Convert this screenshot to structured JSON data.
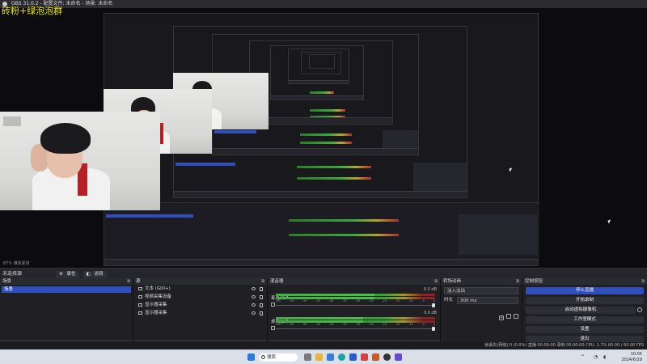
{
  "window": {
    "title": "OBS 31.0.2 - 配置文件: 未命名 - 场景: 未命名"
  },
  "overlay": {
    "text": "砖粉+绿泡泡群"
  },
  "preview_status": "87%  媒体素材",
  "toolbar": {
    "label": "未选择源",
    "properties_label": "属性",
    "filters_label": "滤镜"
  },
  "scenes": {
    "title": "场景",
    "items": [
      {
        "label": "场景"
      }
    ]
  },
  "sources": {
    "title": "源",
    "items": [
      {
        "label": "文本 (GDI+)",
        "icon": "text-icon"
      },
      {
        "label": "视频采集设备",
        "icon": "camera-icon"
      },
      {
        "label": "显示器采集",
        "icon": "monitor-icon"
      },
      {
        "label": "显示器采集",
        "icon": "monitor-icon"
      }
    ]
  },
  "mixer": {
    "title": "混音器",
    "channels": [
      {
        "name": "麦克风/Aux",
        "db": "0.0 dB",
        "level": 0.62
      },
      {
        "name": "桌面音频",
        "db": "0.0 dB",
        "level": 0.55
      }
    ],
    "scale": [
      "-60",
      "-55",
      "-50",
      "-45",
      "-40",
      "-35",
      "-30",
      "-25",
      "-20",
      "-15",
      "-10",
      "-5",
      "0"
    ]
  },
  "transitions": {
    "title": "转场动画",
    "selected": "淡入淡出",
    "duration_label": "时长",
    "duration": "300 ms"
  },
  "controls": {
    "title": "控制按钮",
    "buttons": [
      "停止直播",
      "开始录制",
      "启动虚拟摄像机",
      "工作室模式",
      "设置",
      "退出"
    ]
  },
  "statusbar": {
    "text": "帧丢失(网络) 0 (0.0%)   直播 00:00:00   录制 00:00:00   CPU: 1.7%   60.00 / 60.00 FPS"
  },
  "taskbar": {
    "search_placeholder": "搜索",
    "time": "10:05",
    "date": "2024/6/29"
  },
  "colors": {
    "accent": "#2f4fbf",
    "overlay_text": "#e8e800",
    "panel_bg": "#1f1f24"
  }
}
